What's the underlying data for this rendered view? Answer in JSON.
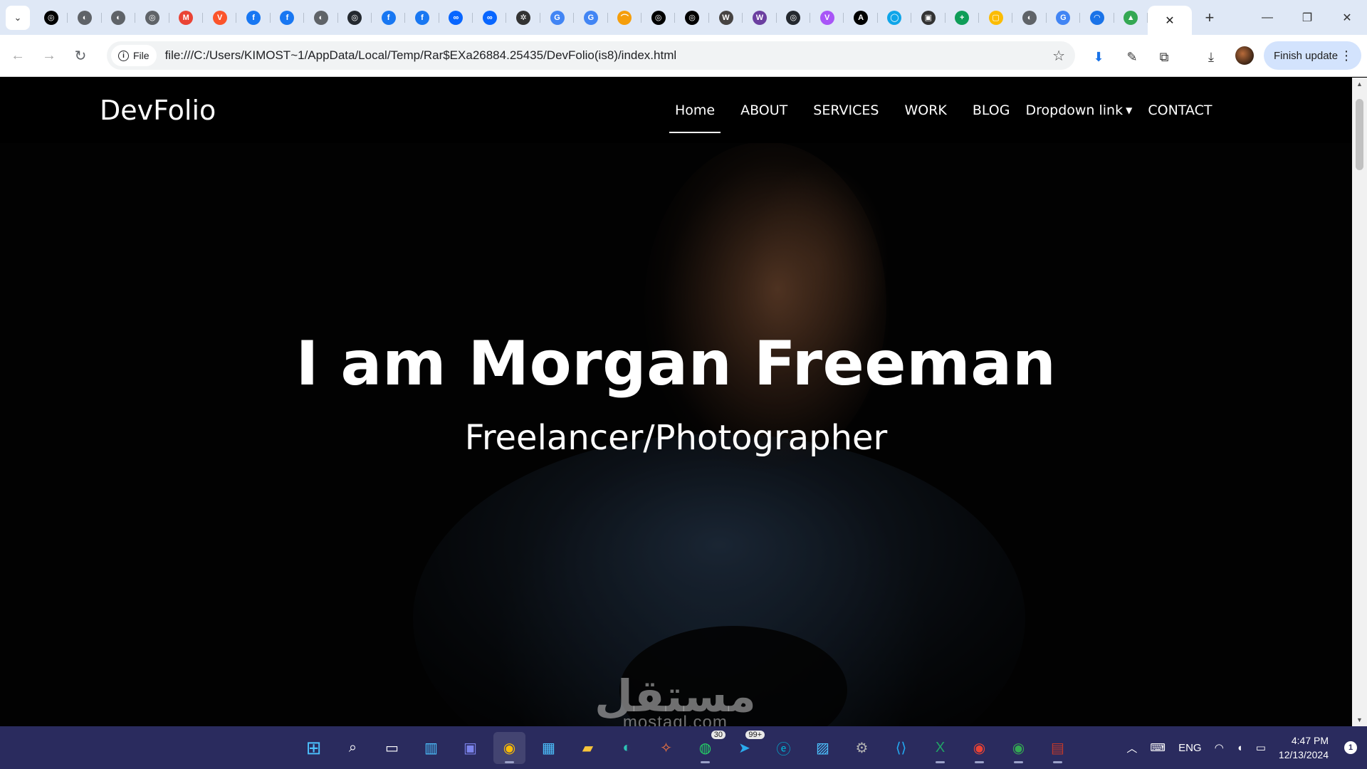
{
  "browser": {
    "tabs": [
      {
        "icon": "openai-icon",
        "color": "#000000",
        "glyph": "◎"
      },
      {
        "icon": "globe-icon",
        "color": "#5f6368",
        "glyph": "◐"
      },
      {
        "icon": "globe-icon",
        "color": "#5f6368",
        "glyph": "◐"
      },
      {
        "icon": "globe-icon",
        "color": "#5f6368",
        "glyph": "◎"
      },
      {
        "icon": "gmail-icon",
        "color": "#ea4335",
        "glyph": "M"
      },
      {
        "icon": "brave-icon",
        "color": "#fb542b",
        "glyph": "V"
      },
      {
        "icon": "facebook-icon",
        "color": "#1877f2",
        "glyph": "f"
      },
      {
        "icon": "facebook-icon",
        "color": "#1877f2",
        "glyph": "f"
      },
      {
        "icon": "globe-icon",
        "color": "#5f6368",
        "glyph": "◐"
      },
      {
        "icon": "github-icon",
        "color": "#24292f",
        "glyph": "◎"
      },
      {
        "icon": "facebook-icon",
        "color": "#1877f2",
        "glyph": "f"
      },
      {
        "icon": "facebook-icon",
        "color": "#1877f2",
        "glyph": "f"
      },
      {
        "icon": "meta-icon",
        "color": "#0866ff",
        "glyph": "∞"
      },
      {
        "icon": "meta-icon",
        "color": "#0866ff",
        "glyph": "∞"
      },
      {
        "icon": "chatgpt-icon",
        "color": "#333333",
        "glyph": "✲"
      },
      {
        "icon": "google-icon",
        "color": "#4285f4",
        "glyph": "G"
      },
      {
        "icon": "google-icon",
        "color": "#4285f4",
        "glyph": "G"
      },
      {
        "icon": "arc-icon",
        "color": "#f59e0b",
        "glyph": "⌒"
      },
      {
        "icon": "openai-icon",
        "color": "#000000",
        "glyph": "◎"
      },
      {
        "icon": "openai-icon",
        "color": "#000000",
        "glyph": "◎"
      },
      {
        "icon": "wordpress-icon",
        "color": "#464342",
        "glyph": "W"
      },
      {
        "icon": "w-icon",
        "color": "#6b3fa0",
        "glyph": "W"
      },
      {
        "icon": "github-icon",
        "color": "#24292f",
        "glyph": "◎"
      },
      {
        "icon": "vuetify-icon",
        "color": "#a855f7",
        "glyph": "V"
      },
      {
        "icon": "a-icon",
        "color": "#000000",
        "glyph": "A"
      },
      {
        "icon": "circle-icon",
        "color": "#0ea5e9",
        "glyph": "◯"
      },
      {
        "icon": "contact-icon",
        "color": "#333333",
        "glyph": "▣"
      },
      {
        "icon": "sheets-icon",
        "color": "#0f9d58",
        "glyph": "+"
      },
      {
        "icon": "keep-icon",
        "color": "#fbbc04",
        "glyph": "▢"
      },
      {
        "icon": "globe-icon",
        "color": "#5f6368",
        "glyph": "◐"
      },
      {
        "icon": "google-icon",
        "color": "#4285f4",
        "glyph": "G"
      },
      {
        "icon": "arc-icon",
        "color": "#1a73e8",
        "glyph": "◠"
      },
      {
        "icon": "drive-icon",
        "color": "#34a853",
        "glyph": "▲"
      }
    ],
    "chip_label": "File",
    "url": "file:///C:/Users/KIMOST~1/AppData/Local/Temp/Rar$EXa26884.25435/DevFolio(is8)/index.html",
    "finish_update": "Finish update"
  },
  "site": {
    "brand": "DevFolio",
    "nav": {
      "home": "Home",
      "about": "ABOUT",
      "services": "SERVICES",
      "work": "WORK",
      "blog": "BLOG",
      "dropdown": "Dropdown link",
      "contact": "CONTACT"
    },
    "hero_title": "I am Morgan Freeman",
    "hero_subtitle": "Freelancer/Photographer"
  },
  "watermark": {
    "arabic": "مستقل",
    "latin": "mostaql.com"
  },
  "taskbar": {
    "badges": {
      "whatsapp": "30",
      "telegram": "99+"
    },
    "tray": {
      "language": "ENG",
      "time": "4:47 PM",
      "date": "12/13/2024",
      "notifications": "1"
    }
  },
  "colors": {
    "tabstrip": "#dfe8f6",
    "taskbar": "#2a2b5e",
    "finish_update_bg": "#d3e3fd"
  }
}
